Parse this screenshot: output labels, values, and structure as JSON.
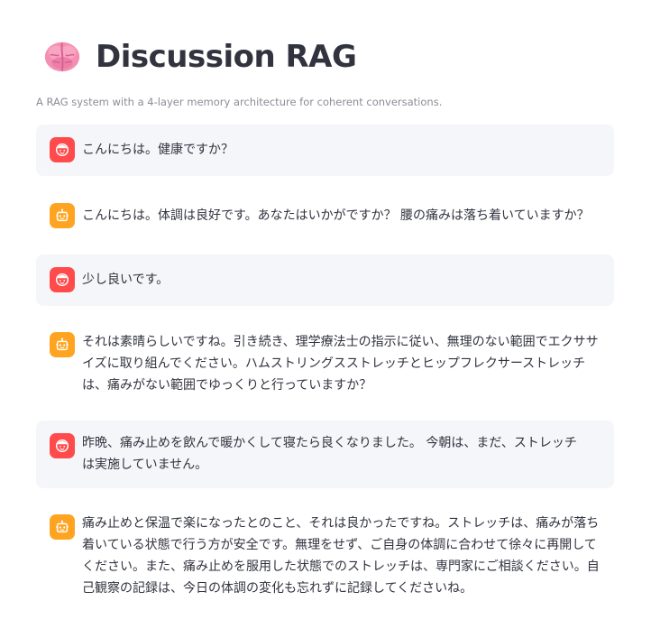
{
  "app": {
    "title": "Discussion RAG",
    "subtitle": "A RAG system with a 4-layer memory architecture for coherent conversations.",
    "title_icon": "brain-emoji-icon"
  },
  "colors": {
    "user_avatar": "#ff4b4b",
    "assistant_avatar": "#ffa421",
    "user_bubble": "#f5f6f9"
  },
  "messages": [
    {
      "role": "user",
      "avatar_icon": "user-face-icon",
      "text": "こんにちは。健康ですか？"
    },
    {
      "role": "assistant",
      "avatar_icon": "robot-icon",
      "text": "こんにちは。体調は良好です。あなたはいかがですか？ 腰の痛みは落ち着いていますか？"
    },
    {
      "role": "user",
      "avatar_icon": "user-face-icon",
      "text": "少し良いです。"
    },
    {
      "role": "assistant",
      "avatar_icon": "robot-icon",
      "text": "それは素晴らしいですね。引き続き、理学療法士の指示に従い、無理のない範囲でエクササイズに取り組んでください。ハムストリングスストレッチとヒップフレクサーストレッチは、痛みがない範囲でゆっくりと行っていますか？"
    },
    {
      "role": "user",
      "avatar_icon": "user-face-icon",
      "text": "昨晩、痛み止めを飲んで暖かくして寝たら良くなりました。 今朝は、まだ、ストレッチは実施していません。"
    },
    {
      "role": "assistant",
      "avatar_icon": "robot-icon",
      "text": "痛み止めと保温で楽になったとのこと、それは良かったですね。ストレッチは、痛みが落ち着いている状態で行う方が安全です。無理をせず、ご自身の体調に合わせて徐々に再開してください。また、痛み止めを服用した状態でのストレッチは、専門家にご相談ください。自己観察の記録は、今日の体調の変化も忘れずに記録してくださいね。"
    }
  ]
}
